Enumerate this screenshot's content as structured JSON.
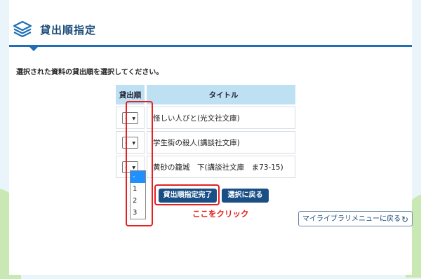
{
  "header": {
    "title": "貸出順指定",
    "icon": "layers-icon",
    "accent": "#1e6fb5"
  },
  "instruction": "選択された資料の貸出順を選択してください。",
  "table": {
    "headers": [
      "貸出順",
      "タイトル"
    ],
    "rows": [
      {
        "order": "-",
        "title": "怪しい人びと(光文社文庫)"
      },
      {
        "order": "-",
        "title": "学生街の殺人(講談社文庫)"
      },
      {
        "order": "-",
        "title": "黄砂の籠城　下(講談社文庫　ま73-15)"
      }
    ]
  },
  "dropdown": {
    "options": [
      "-",
      "1",
      "2",
      "3"
    ],
    "highlighted": "-"
  },
  "buttons": {
    "done": "貸出順指定完了",
    "back": "選択に戻る",
    "menu": "マイライブラリメニューに戻る"
  },
  "annotation": {
    "text": "ここをクリック",
    "color": "#e52020"
  }
}
